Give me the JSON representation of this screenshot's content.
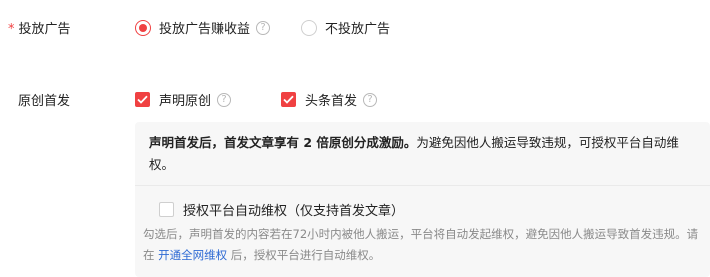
{
  "ad": {
    "required_mark": "*",
    "label": "投放广告",
    "options": [
      {
        "label": "投放广告赚收益",
        "selected": true
      },
      {
        "label": "不投放广告",
        "selected": false
      }
    ],
    "help_glyph": "?"
  },
  "original": {
    "label": "原创首发",
    "options": [
      {
        "label": "声明原创",
        "checked": true
      },
      {
        "label": "头条首发",
        "checked": true
      }
    ],
    "help_glyph": "?"
  },
  "panel": {
    "bold_text": "声明首发后，首发文章享有 2 倍原创分成激励。",
    "normal_text": "为避免因他人搬运导致违规，可授权平台自动维权。",
    "auth_checkbox": {
      "label": "授权平台自动维权（仅支持首发文章）",
      "checked": false
    },
    "desc_before": "勾选后，声明首发的内容若在72小时内被他人搬运，平台将自动发起维权，避免因他人搬运导致首发违规。请在 ",
    "desc_link": "开通全网维权",
    "desc_after": " 后，授权平台进行自动维权。"
  },
  "colors": {
    "accent": "#f04142",
    "link": "#2f6bd4"
  }
}
